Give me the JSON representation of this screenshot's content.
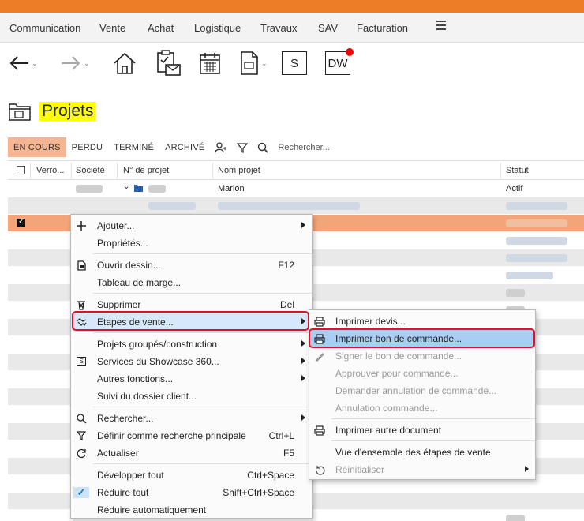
{
  "menu": {
    "items": [
      "Communication",
      "Vente",
      "Achat",
      "Logistique",
      "Travaux",
      "SAV",
      "Facturation"
    ]
  },
  "toolbar": {
    "s_label": "S",
    "dw_label": "DW"
  },
  "page": {
    "title": "Projets"
  },
  "filters": {
    "tabs": [
      "EN COURS",
      "PERDU",
      "TERMINÉ",
      "ARCHIVÉ"
    ],
    "search_placeholder": "Rechercher..."
  },
  "grid": {
    "columns": [
      "Verro...",
      "Société",
      "N° de projet",
      "Nom projet",
      "Statut"
    ],
    "first_row": {
      "nom_projet": "Marion",
      "statut": "Actif"
    }
  },
  "context_menu": {
    "items": [
      {
        "label": "Ajouter...",
        "icon": "plus-icon",
        "submenu": true
      },
      {
        "label": "Propriétés..."
      },
      {
        "label": "Ouvrir dessin...",
        "icon": "drawing-icon",
        "shortcut": "F12"
      },
      {
        "label": "Tableau de marge..."
      },
      {
        "label": "Supprimer",
        "icon": "trash-icon",
        "shortcut": "Del"
      },
      {
        "label": "Etapes de vente...",
        "icon": "handshake-icon",
        "submenu": true
      },
      {
        "label": "Projets groupés/construction",
        "submenu": true
      },
      {
        "label": "Services du Showcase 360...",
        "icon": "s-box-icon",
        "submenu": true
      },
      {
        "label": "Autres fonctions...",
        "submenu": true
      },
      {
        "label": "Suivi du dossier client..."
      },
      {
        "label": "Rechercher...",
        "icon": "search-icon",
        "submenu": true
      },
      {
        "label": "Définir comme recherche principale",
        "icon": "filter-icon",
        "shortcut": "Ctrl+L"
      },
      {
        "label": "Actualiser",
        "icon": "refresh-icon",
        "shortcut": "F5"
      },
      {
        "label": "Développer tout",
        "shortcut": "Ctrl+Space"
      },
      {
        "label": "Réduire tout",
        "icon": "check-icon",
        "shortcut": "Shift+Ctrl+Space"
      },
      {
        "label": "Réduire automatiquement"
      }
    ]
  },
  "submenu": {
    "items": [
      {
        "label": "Imprimer devis...",
        "icon": "printer-icon"
      },
      {
        "label": "Imprimer bon de commande...",
        "icon": "printer-icon"
      },
      {
        "label": "Signer le bon de commande...",
        "icon": "pen-icon",
        "disabled": true
      },
      {
        "label": "Approuver pour commande...",
        "disabled": true
      },
      {
        "label": "Demander annulation de commande...",
        "disabled": true
      },
      {
        "label": "Annulation commande...",
        "disabled": true
      },
      {
        "label": "Imprimer autre document",
        "icon": "printer-icon"
      },
      {
        "label": "Vue d'ensemble des étapes de vente"
      },
      {
        "label": "Réinitialiser",
        "icon": "reset-icon",
        "disabled": true,
        "submenu": true
      }
    ]
  },
  "colors": {
    "accent_orange": "#ee7d27",
    "selected_row": "#f3a57a",
    "active_tab": "#f6b591",
    "title_highlight": "#ffff00",
    "menu_highlight": "#a9cef3",
    "annotation_red": "#e0102a"
  }
}
